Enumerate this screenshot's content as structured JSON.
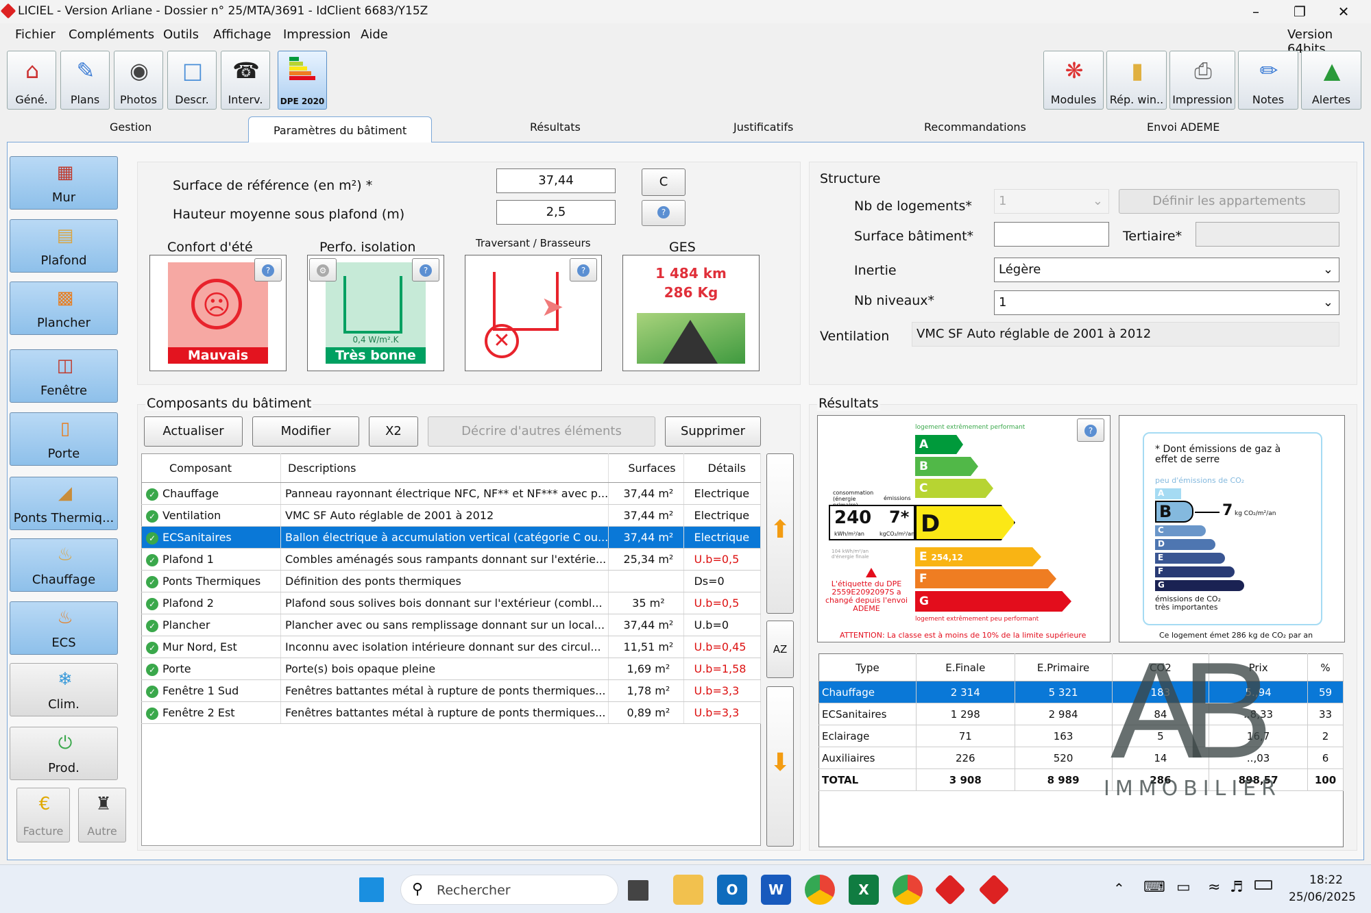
{
  "window": {
    "title": "LICIEL - Version Arliane - Dossier n° 25/MTA/3691 - IdClient 6683/Y15Z",
    "version": "Version 64bits"
  },
  "menu": [
    "Fichier",
    "Compléments",
    "Outils",
    "Affichage",
    "Impression",
    "Aide"
  ],
  "toolbar_left": [
    "Géné.",
    "Plans",
    "Photos",
    "Descr.",
    "Interv."
  ],
  "toolbar_dpe": "DPE 2020",
  "toolbar_right": [
    "Modules",
    "Rép. win..",
    "Impression",
    "Notes",
    "Alertes"
  ],
  "tabs": [
    "Gestion",
    "Paramètres du bâtiment",
    "Résultats",
    "Justificatifs",
    "Recommandations",
    "Envoi ADEME"
  ],
  "sidebar": [
    "Mur",
    "Plafond",
    "Plancher",
    "Fenêtre",
    "Porte",
    "Ponts  Thermiq...",
    "Chauffage",
    "ECS",
    "Clim.",
    "Prod."
  ],
  "sidebar_small": [
    "Facture",
    "Autre"
  ],
  "params": {
    "surface_label": "Surface de référence (en m²) *",
    "surface_value": "37,44",
    "c_button": "C",
    "hauteur_label": "Hauteur moyenne sous plafond (m)",
    "hauteur_value": "2,5",
    "confort_label": "Confort d'été",
    "confort_value": "Mauvais",
    "perfo_label": "Perfo. isolation",
    "perfo_value": "Très bonne",
    "perfo_u": "0,4 W/m².K",
    "traversant_label": "Traversant / Brasseurs",
    "ges_label": "GES",
    "ges_km": "1 484 km",
    "ges_kg": "286 Kg"
  },
  "structure": {
    "title": "Structure",
    "nb_logements_label": "Nb de logements*",
    "nb_logements_value": "1",
    "definir_button": "Définir les appartements",
    "surface_batiment_label": "Surface bâtiment*",
    "tertiaire_label": "Tertiaire*",
    "inertie_label": "Inertie",
    "inertie_value": "Légère",
    "nb_niveaux_label": "Nb niveaux*",
    "nb_niveaux_value": "1",
    "ventilation_label": "Ventilation",
    "ventilation_value": "VMC SF Auto réglable de 2001 à 2012"
  },
  "composants": {
    "title": "Composants du bâtiment",
    "buttons": [
      "Actualiser",
      "Modifier",
      "X2",
      "Décrire d'autres éléments",
      "Supprimer"
    ],
    "headers": [
      "Composant",
      "Descriptions",
      "Surfaces",
      "Détails"
    ],
    "rows": [
      {
        "c": "Chauffage",
        "d": "Panneau rayonnant électrique NFC, NF** et NF*** avec p...",
        "s": "37,44 m²",
        "det": "Electrique"
      },
      {
        "c": "Ventilation",
        "d": "VMC SF Auto réglable de 2001 à 2012",
        "s": "37,44 m²",
        "det": "Electrique"
      },
      {
        "c": "ECSanitaires",
        "d": "Ballon électrique à accumulation vertical (catégorie C ou...",
        "s": "37,44 m²",
        "det": "Electrique"
      },
      {
        "c": "Plafond  1",
        "d": "Combles aménagés sous rampants donnant sur l'extérie...",
        "s": "25,34 m²",
        "det": "U.b=0,5"
      },
      {
        "c": "Ponts Thermiques",
        "d": "Définition des ponts thermiques",
        "s": "",
        "det": "Ds=0"
      },
      {
        "c": "Plafond  2",
        "d": "Plafond sous solives bois donnant sur l'extérieur (combl...",
        "s": "35 m²",
        "det": "U.b=0,5"
      },
      {
        "c": "Plancher",
        "d": "Plancher avec ou sans remplissage donnant sur un local...",
        "s": "37,44 m²",
        "det": "U.b=0"
      },
      {
        "c": "Mur Nord, Est",
        "d": "Inconnu avec isolation intérieure donnant sur des circul...",
        "s": "11,51 m²",
        "det": "U.b=0,45"
      },
      {
        "c": "Porte",
        "d": "Porte(s) bois opaque pleine",
        "s": "1,69 m²",
        "det": "U.b=1,58"
      },
      {
        "c": "Fenêtre  1 Sud",
        "d": "Fenêtres battantes métal à rupture de ponts thermiques...",
        "s": "1,78 m²",
        "det": "U.b=3,3"
      },
      {
        "c": "Fenêtre  2 Est",
        "d": "Fenêtres battantes métal à rupture de ponts thermiques...",
        "s": "0,89 m²",
        "det": "U.b=3,3"
      }
    ],
    "az": "AZ"
  },
  "resultats": {
    "title": "Résultats",
    "dpe": {
      "top": "logement extrêmement performant",
      "bottom": "logement extrêmement peu performant",
      "letters": [
        "A",
        "B",
        "C",
        "D",
        "E",
        "F",
        "G"
      ],
      "conso_hdr": "consommation (énergie primaire)",
      "emis_hdr": "émissions",
      "conso": "240",
      "conso_unit": "kWh/m²/an",
      "emis": "7*",
      "emis_unit": "kgCO₂/m²/an",
      "ef": "104 kWh/m²/an d'énergie finale",
      "e_label": "254,12",
      "note": "L'étiquette du DPE 2559E2092097S a changé depuis l'envoi ADEME",
      "attention": "ATTENTION: La classe est à moins de 10% de la limite supérieure"
    },
    "ges": {
      "head": "* Dont émissions de gaz à effet de serre",
      "low": "peu d'émissions de CO₂",
      "value": "7",
      "unit": "kg CO₂/m²/an",
      "letters": [
        "A",
        "B",
        "C",
        "D",
        "E",
        "F",
        "G"
      ],
      "high": "émissions de CO₂ très importantes",
      "foot": "Ce logement émet 286 kg de CO₂ par an"
    },
    "headers": [
      "Type",
      "E.Finale",
      "E.Primaire",
      "CO2",
      "Prix",
      "%"
    ],
    "rows": [
      [
        "Chauffage",
        "2 314",
        "5 321",
        "183",
        "5.,94",
        "59"
      ],
      [
        "ECSanitaires",
        "1 298",
        "2 984",
        "84",
        "..8,33",
        "33"
      ],
      [
        "Eclairage",
        "71",
        "163",
        "5",
        "16,7",
        "2"
      ],
      [
        "Auxiliaires",
        "226",
        "520",
        "14",
        "..,03",
        "6"
      ],
      [
        "TOTAL",
        "3 908",
        "8 989",
        "286",
        "898,57",
        "100"
      ]
    ]
  },
  "watermark": {
    "letters": "AB",
    "word": "IMMOBILIER"
  },
  "taskbar": {
    "search": "Rechercher",
    "time": "18:22",
    "date": "25/06/2025"
  },
  "colors": {
    "dpe": [
      "#009a3b",
      "#51b848",
      "#b7d432",
      "#fbe816",
      "#f9b414",
      "#ef7d22",
      "#e30d1c"
    ],
    "ges": [
      "#a5dbf3",
      "#84b9de",
      "#6a96c9",
      "#4e76b1",
      "#3a5693",
      "#283a74",
      "#1a2253"
    ],
    "select": "#0a78d7"
  }
}
